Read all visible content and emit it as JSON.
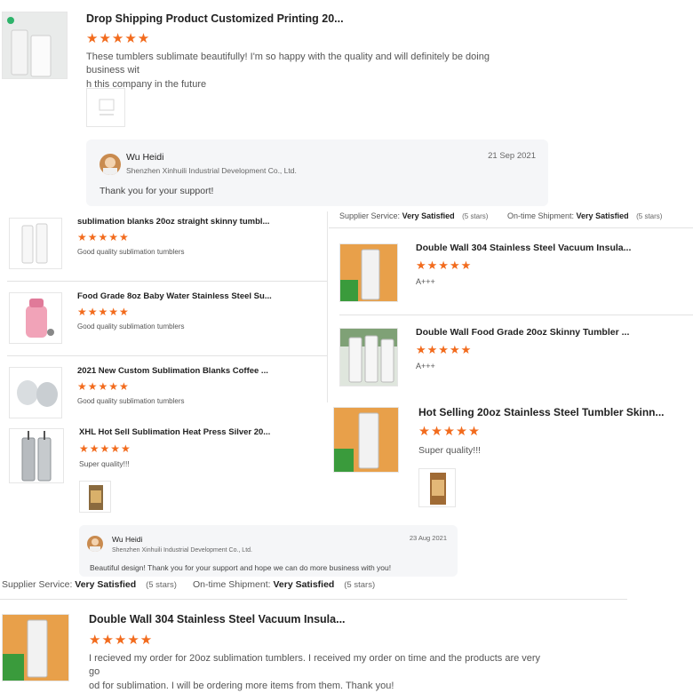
{
  "review1": {
    "title": "Drop Shipping Product Customized Printing 20...",
    "stars": "★★★★★",
    "text_line1": "These tumblers sublimate beautifully! I'm so happy with the quality and will definitely be doing business wit",
    "text_line2": "h this company in the future",
    "reply": {
      "name": "Wu Heidi",
      "company": "Shenzhen Xinhuili Industrial Development Co., Ltd.",
      "date": "21 Sep 2021",
      "message": "Thank you for your support!"
    }
  },
  "service_top": {
    "supplier_label": "Supplier Service:",
    "supplier_value": "Very Satisfied",
    "supplier_stars": "(5 stars)",
    "shipment_label": "On-time Shipment:",
    "shipment_value": "Very Satisfied",
    "shipment_stars": "(5 stars)"
  },
  "left_list": [
    {
      "title": "sublimation blanks 20oz straight skinny tumbl...",
      "stars": "★★★★★",
      "text": "Good quality sublimation tumblers"
    },
    {
      "title": "Food Grade 8oz Baby Water Stainless Steel Su...",
      "stars": "★★★★★",
      "text": "Good quality sublimation tumblers"
    },
    {
      "title": "2021 New Custom Sublimation Blanks Coffee ...",
      "stars": "★★★★★",
      "text": "Good quality sublimation tumblers"
    }
  ],
  "right_list": [
    {
      "title": "Double Wall 304 Stainless Steel Vacuum Insula...",
      "stars": "★★★★★",
      "text": "A+++"
    },
    {
      "title": "Double Wall Food Grade 20oz Skinny Tumbler ...",
      "stars": "★★★★★",
      "text": "A+++"
    }
  ],
  "review_xhl": {
    "title": "XHL Hot Sell Sublimation Heat Press Silver 20...",
    "stars": "★★★★★",
    "text": "Super quality!!!",
    "reply": {
      "name": "Wu Heidi",
      "company": "Shenzhen Xinhuili Industrial Development Co., Ltd.",
      "date": "23 Aug 2021",
      "message": "Beautiful design! Thank you for your support and hope we can do more business with you!"
    }
  },
  "review_hot": {
    "title": "Hot Selling 20oz Stainless Steel Tumbler Skinn...",
    "stars": "★★★★★",
    "text": "Super quality!!!"
  },
  "service_bottom": {
    "supplier_label": "Supplier Service:",
    "supplier_value": "Very Satisfied",
    "supplier_stars": "(5 stars)",
    "shipment_label": "On-time Shipment:",
    "shipment_value": "Very Satisfied",
    "shipment_stars": "(5 stars)"
  },
  "review_last": {
    "title": "Double Wall 304 Stainless Steel Vacuum Insula...",
    "stars": "★★★★★",
    "text_line1": "I recieved my order for 20oz sublimation tumblers. I received my order on time and the products are very go",
    "text_line2": "od for sublimation. I will be ordering more items from them. Thank you!"
  },
  "colors": {
    "star": "#f26b1d",
    "reply_bg": "#f5f6f8",
    "divider": "#e2e2e2"
  }
}
